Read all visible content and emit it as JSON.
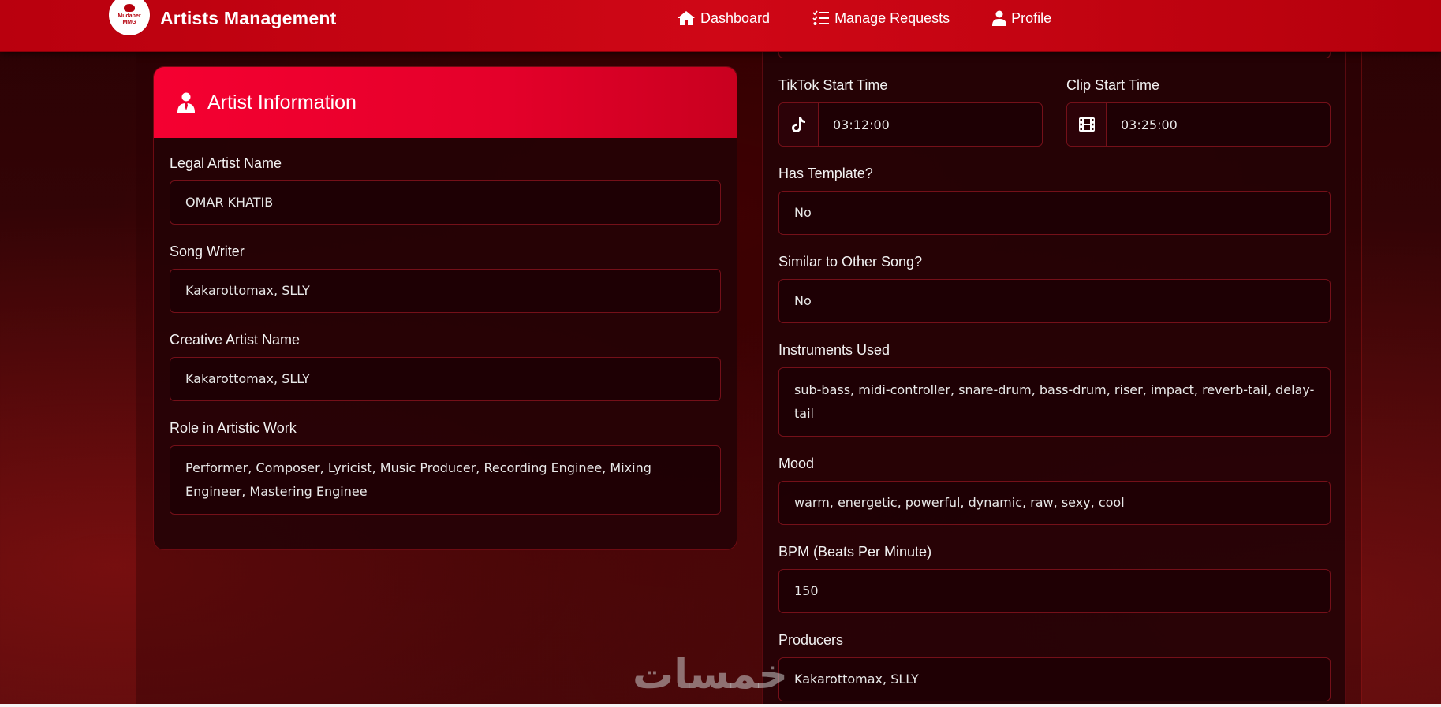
{
  "navbar": {
    "logo_text": "Mudaber MMG",
    "title": "Artists Management",
    "links": [
      {
        "label": "Dashboard",
        "icon": "home-icon"
      },
      {
        "label": "Manage Requests",
        "icon": "list-check-icon"
      },
      {
        "label": "Profile",
        "icon": "user-icon"
      }
    ]
  },
  "artist_card": {
    "title": "Artist Information",
    "icon": "user-tie-icon",
    "fields": [
      {
        "label": "Legal Artist Name",
        "value": "OMAR KHATIB"
      },
      {
        "label": "Song Writer",
        "value": "Kakarottomax, SLLY"
      },
      {
        "label": "Creative Artist Name",
        "value": "Kakarottomax, SLLY"
      },
      {
        "label": "Role in Artistic Work",
        "value": "Performer, Composer, Lyricist, Music Producer, Recording Enginee, Mixing Engineer, Mastering Enginee"
      }
    ]
  },
  "song_details": {
    "tiktok_start": {
      "label": "TikTok Start Time",
      "value": "03:12:00",
      "icon": "tiktok-icon"
    },
    "clip_start": {
      "label": "Clip Start Time",
      "value": "03:25:00",
      "icon": "film-icon"
    },
    "has_template": {
      "label": "Has Template?",
      "value": "No"
    },
    "similar_song": {
      "label": "Similar to Other Song?",
      "value": "No"
    },
    "instruments": {
      "label": "Instruments Used",
      "value": "sub-bass, midi-controller, snare-drum, bass-drum, riser, impact, reverb-tail, delay-tail"
    },
    "mood": {
      "label": "Mood",
      "value": "warm, energetic, powerful, dynamic, raw, sexy, cool"
    },
    "bpm": {
      "label": "BPM (Beats Per Minute)",
      "value": "150"
    },
    "producers": {
      "label": "Producers",
      "value": "Kakarottomax, SLLY"
    }
  },
  "watermark": {
    "text": "خمسات"
  },
  "colors": {
    "accent": "#e4002a",
    "navbar": "#c4000f",
    "field_border": "#741019",
    "background": "#2a0204"
  }
}
